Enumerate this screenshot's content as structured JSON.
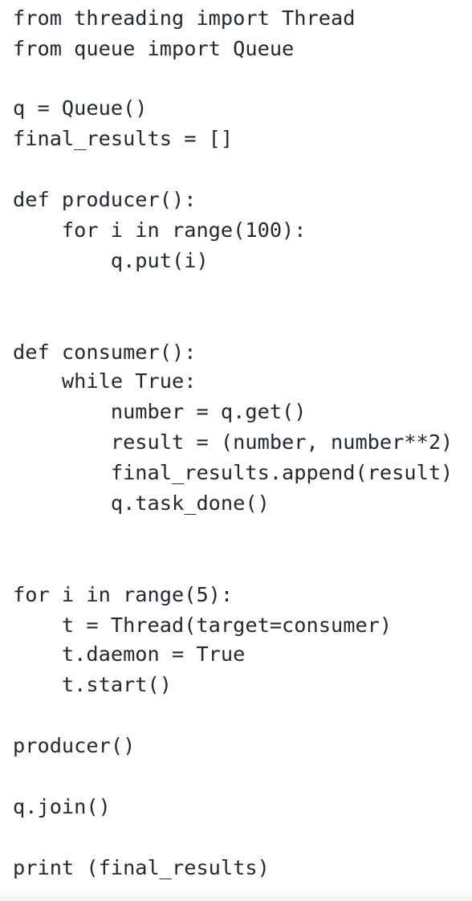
{
  "code": {
    "language": "python",
    "lines": [
      "from threading import Thread",
      "from queue import Queue",
      "",
      "q = Queue()",
      "final_results = []",
      "",
      "def producer():",
      "    for i in range(100):",
      "        q.put(i)",
      "",
      "",
      "def consumer():",
      "    while True:",
      "        number = q.get()",
      "        result = (number, number**2)",
      "        final_results.append(result)",
      "        q.task_done()",
      "",
      "",
      "for i in range(5):",
      "    t = Thread(target=consumer)",
      "    t.daemon = True",
      "    t.start()",
      "",
      "producer()",
      "",
      "q.join()",
      "",
      "print (final_results)"
    ]
  }
}
